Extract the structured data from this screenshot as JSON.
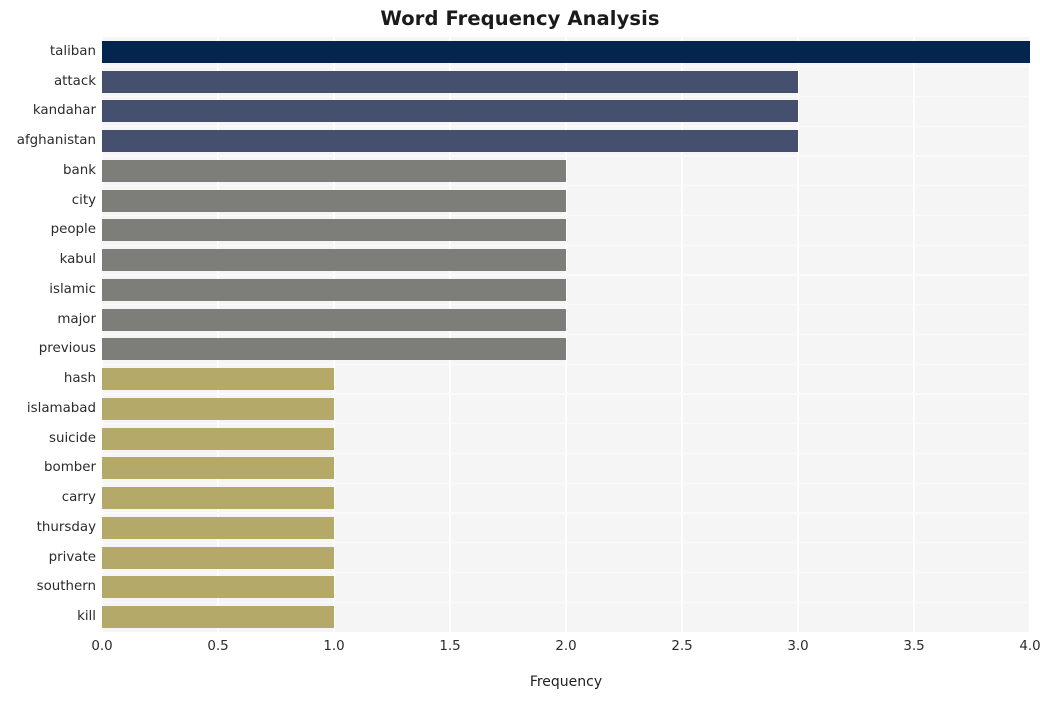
{
  "chart_data": {
    "type": "bar",
    "orientation": "horizontal",
    "title": "Word Frequency Analysis",
    "xlabel": "Frequency",
    "ylabel": "",
    "categories": [
      "taliban",
      "attack",
      "kandahar",
      "afghanistan",
      "bank",
      "city",
      "people",
      "kabul",
      "islamic",
      "major",
      "previous",
      "hash",
      "islamabad",
      "suicide",
      "bomber",
      "carry",
      "thursday",
      "private",
      "southern",
      "kill"
    ],
    "values": [
      4,
      3,
      3,
      3,
      2,
      2,
      2,
      2,
      2,
      2,
      2,
      1,
      1,
      1,
      1,
      1,
      1,
      1,
      1,
      1
    ],
    "bar_colors": [
      "#04264e",
      "#454f6e",
      "#454f6e",
      "#454f6e",
      "#7d7d7a",
      "#7d7d7a",
      "#7d7d7a",
      "#7d7d7a",
      "#7d7d7a",
      "#7d7d7a",
      "#7d7d7a",
      "#b5a96a",
      "#b5a96a",
      "#b5a96a",
      "#b5a96a",
      "#b5a96a",
      "#b5a96a",
      "#b5a96a",
      "#b5a96a",
      "#b5a96a"
    ],
    "xlim": [
      0.0,
      4.0
    ],
    "xticks": [
      0.0,
      0.5,
      1.0,
      1.5,
      2.0,
      2.5,
      3.0,
      3.5,
      4.0
    ],
    "xtick_labels": [
      "0.0",
      "0.5",
      "1.0",
      "1.5",
      "2.0",
      "2.5",
      "3.0",
      "3.5",
      "4.0"
    ],
    "grid": true,
    "grid_color": "#ffffff",
    "plot_background": "#f5f5f5",
    "figure_background": "#ffffff",
    "legend": null
  }
}
